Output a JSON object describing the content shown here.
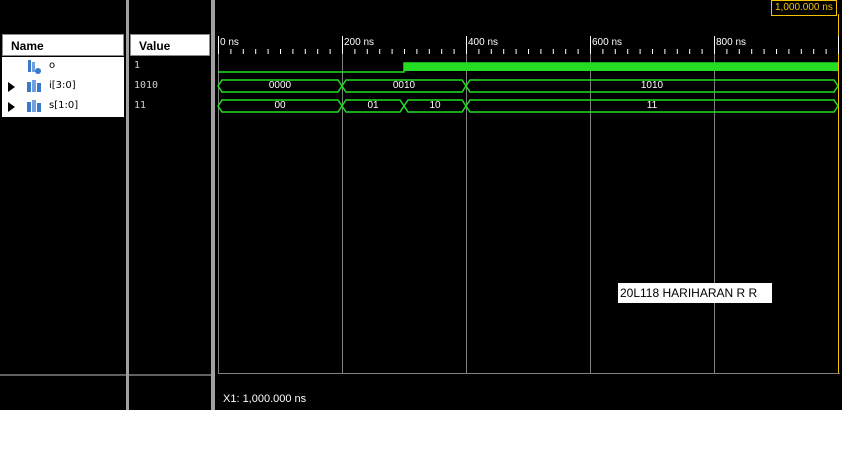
{
  "headers": {
    "name": "Name",
    "value": "Value"
  },
  "signals": [
    {
      "name": "o",
      "value": "1",
      "icon": "scalar-signal-icon",
      "expandable": false
    },
    {
      "name": "i[3:0]",
      "value": "1010",
      "icon": "bus-signal-icon",
      "expandable": true
    },
    {
      "name": "s[1:0]",
      "value": "11",
      "icon": "bus-signal-icon",
      "expandable": true
    }
  ],
  "timeline": {
    "ticks": [
      "0 ns",
      "200 ns",
      "400 ns",
      "600 ns",
      "800 ns"
    ],
    "cursor_time": "1,000.000 ns",
    "x_readout": "X1: 1,000.000 ns"
  },
  "waves": {
    "o": [
      {
        "from": 0,
        "to": 300,
        "level": 0
      },
      {
        "from": 300,
        "to": 1000,
        "level": 1
      }
    ],
    "i": [
      {
        "from": 0,
        "to": 200,
        "label": "0000"
      },
      {
        "from": 200,
        "to": 400,
        "label": "0010"
      },
      {
        "from": 400,
        "to": 1000,
        "label": "1010"
      }
    ],
    "s": [
      {
        "from": 0,
        "to": 200,
        "label": "00"
      },
      {
        "from": 200,
        "to": 300,
        "label": "01"
      },
      {
        "from": 300,
        "to": 400,
        "label": "10"
      },
      {
        "from": 400,
        "to": 1000,
        "label": "11"
      }
    ]
  },
  "annotation": "20L118 HARIHARAN R R",
  "colors": {
    "wave": "#22dd22",
    "cursor": "#f5c400",
    "background": "#000000"
  }
}
